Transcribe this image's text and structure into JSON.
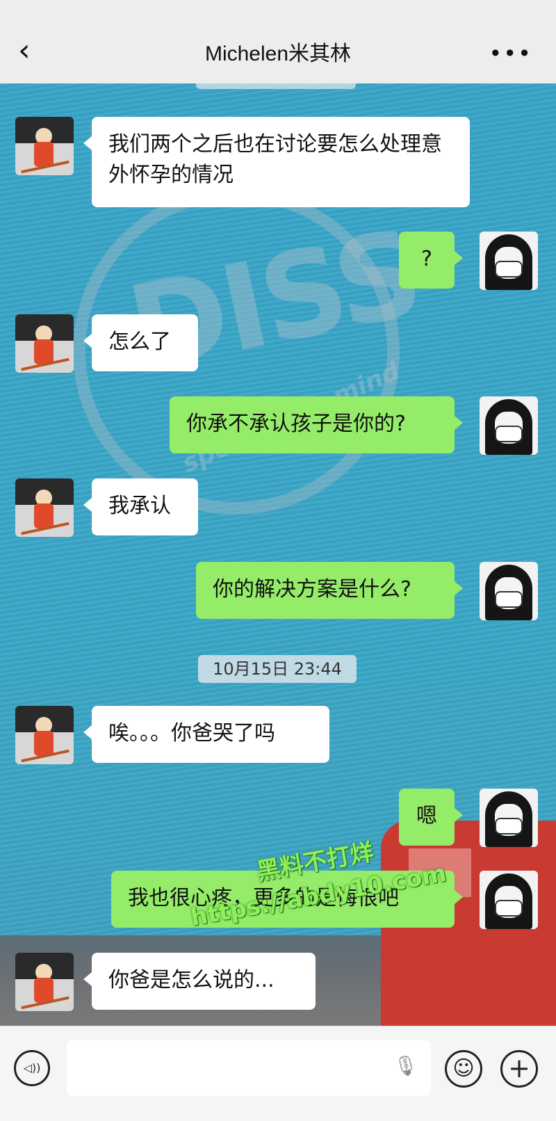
{
  "header": {
    "back_icon": "chevron-left-icon",
    "back_glyph": "‹",
    "title": "Michelen米其林",
    "more_glyph": "•••"
  },
  "watermark_logo": {
    "big": "DISS",
    "sub": "speak your mind"
  },
  "messages": [
    {
      "side": "in",
      "text": "我们两个之后也在讨论要怎么处理意外怀孕的情况"
    },
    {
      "side": "out",
      "text": "?"
    },
    {
      "side": "in",
      "text": "怎么了"
    },
    {
      "side": "out",
      "text": "你承不承认孩子是你的?"
    },
    {
      "side": "in",
      "text": "我承认"
    },
    {
      "side": "out",
      "text": "你的解决方案是什么?"
    },
    {
      "side": "in",
      "text": "唉。。。你爸哭了吗"
    },
    {
      "side": "out",
      "text": "嗯"
    },
    {
      "side": "out",
      "text": "我也很心疼，更多的是悔恨吧"
    },
    {
      "side": "in",
      "text": "你爸是怎么说的..."
    }
  ],
  "timestamp": "10月15日 23:44",
  "overlay_watermark": {
    "line1": "黑料不打烊",
    "line2": "https://abdy10.com"
  },
  "inputbar": {
    "voice_glyph": "◁))",
    "mic_glyph": "🎙",
    "emoji_glyph": "☺",
    "plus_glyph": "+"
  },
  "colors": {
    "header_bg": "#ededed",
    "bubble_out": "#95ec69",
    "bubble_in": "#ffffff",
    "chat_bg": "#3aa3c4"
  }
}
